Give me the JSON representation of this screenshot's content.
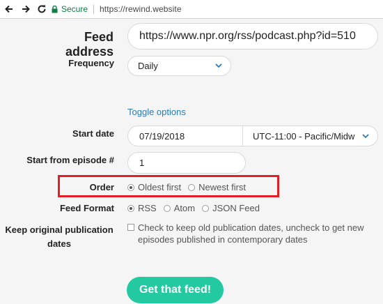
{
  "browser": {
    "secure_label": "Secure",
    "url": "https://rewind.website"
  },
  "form": {
    "feed_address": {
      "label": "Feed address",
      "value": "https://www.npr.org/rss/podcast.php?id=510"
    },
    "frequency": {
      "label": "Frequency",
      "selected": "Daily"
    },
    "toggle_options": "Toggle options",
    "start_date": {
      "label": "Start date",
      "date": "07/19/2018",
      "timezone": "UTC-11:00 - Pacific/Midw"
    },
    "start_episode": {
      "label": "Start from episode #",
      "value": "1"
    },
    "order": {
      "label": "Order",
      "options": [
        "Oldest first",
        "Newest first"
      ],
      "selected": "Oldest first"
    },
    "feed_format": {
      "label": "Feed Format",
      "options": [
        "RSS",
        "Atom",
        "JSON Feed"
      ],
      "selected": "RSS"
    },
    "keep_dates": {
      "label_line1": "Keep original publication",
      "label_line2": "dates",
      "text_line1": "Check to keep old publication dates, uncheck to get new",
      "text_line2": "episodes published in contemporary dates",
      "checked": false
    },
    "submit_label": "Get that feed!"
  },
  "colors": {
    "accent": "#23c9a0",
    "link": "#2a7ab8",
    "highlight": "#e01f26"
  }
}
